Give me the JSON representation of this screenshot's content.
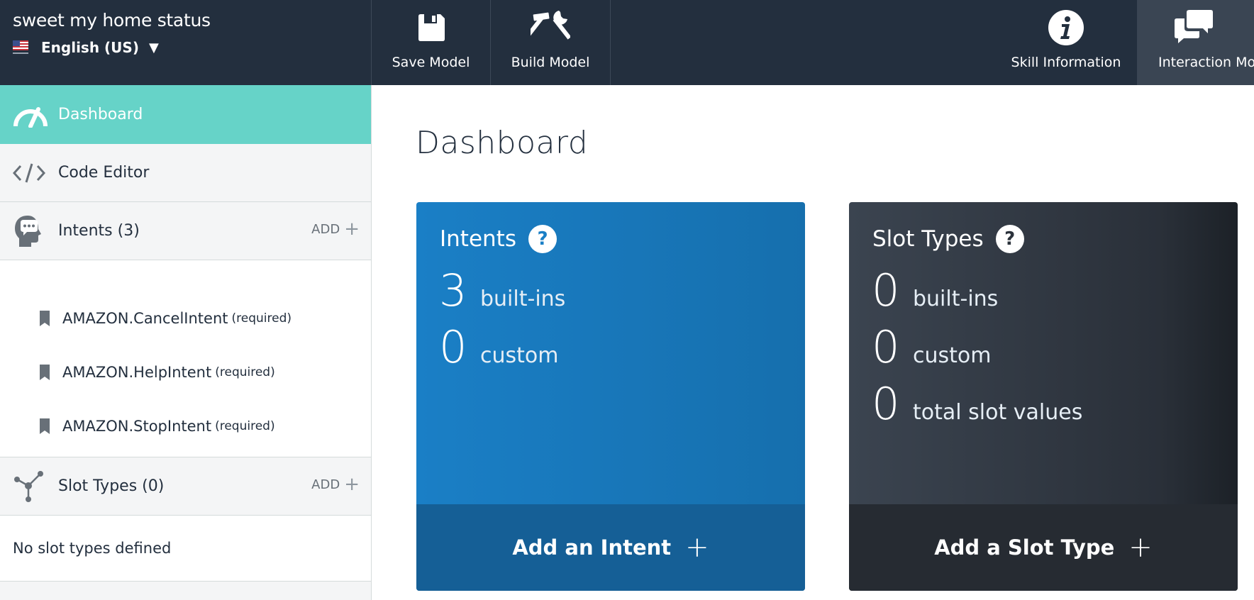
{
  "header": {
    "skill_name": "sweet my home status",
    "locale": "English (US)",
    "locale_caret": "▼",
    "buttons": {
      "save_model": "Save Model",
      "build_model": "Build Model",
      "skill_information": "Skill Information",
      "interaction_model": "Interaction Moc"
    }
  },
  "sidebar": {
    "dashboard": "Dashboard",
    "code_editor": "Code Editor",
    "intents": "Intents (3)",
    "intents_add": "ADD",
    "intent_items": [
      {
        "name": "AMAZON.CancelIntent",
        "note": "(required)"
      },
      {
        "name": "AMAZON.HelpIntent",
        "note": "(required)"
      },
      {
        "name": "AMAZON.StopIntent",
        "note": "(required)"
      }
    ],
    "slot_types": "Slot Types (0)",
    "slot_types_add": "ADD",
    "slot_types_empty": "No slot types defined"
  },
  "main": {
    "title": "Dashboard",
    "intents_card": {
      "title": "Intents",
      "help": "?",
      "stats": [
        {
          "num": "3",
          "label": "built-ins"
        },
        {
          "num": "0",
          "label": "custom"
        }
      ],
      "footer": "Add an Intent",
      "footer_plus": "+"
    },
    "slots_card": {
      "title": "Slot Types",
      "help": "?",
      "stats": [
        {
          "num": "0",
          "label": "built-ins"
        },
        {
          "num": "0",
          "label": "custom"
        },
        {
          "num": "0",
          "label": "total slot values"
        }
      ],
      "footer": "Add a Slot Type",
      "footer_plus": "+"
    }
  },
  "colors": {
    "topbar": "#232f3e",
    "active_nav": "#66d3c8",
    "intents_card": "#1a7fc6",
    "slots_card": "#2a3039"
  }
}
